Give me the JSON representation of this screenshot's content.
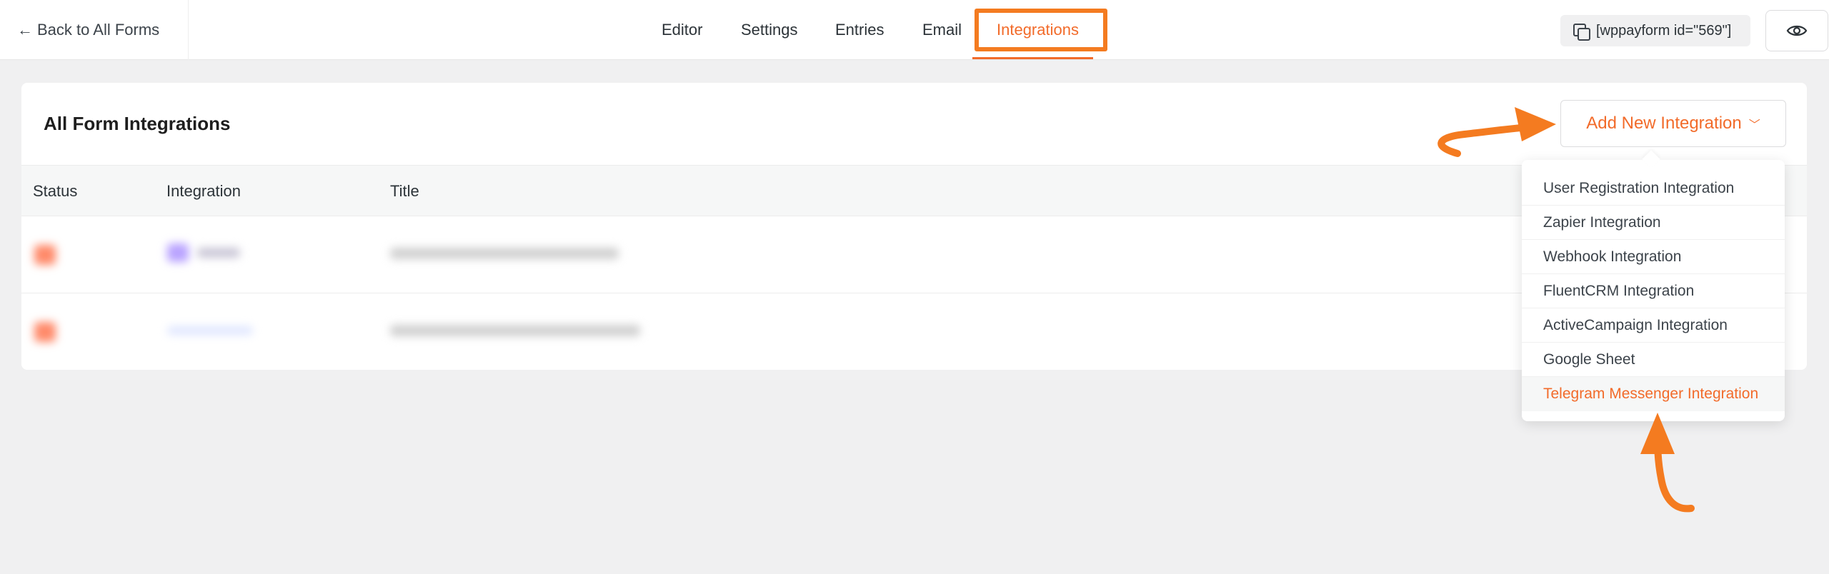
{
  "topbar": {
    "back_label": "Back to All Forms",
    "tabs": [
      {
        "label": "Editor"
      },
      {
        "label": "Settings"
      },
      {
        "label": "Entries"
      },
      {
        "label": "Email"
      },
      {
        "label": "Integrations"
      }
    ],
    "shortcode": "[wppayform id=\"569\"]"
  },
  "card": {
    "title": "All Form Integrations",
    "add_button_label": "Add New Integration"
  },
  "table": {
    "columns": [
      "Status",
      "Integration",
      "Title"
    ]
  },
  "dropdown": {
    "items": [
      "User Registration Integration",
      "Zapier Integration",
      "Webhook Integration",
      "FluentCRM Integration",
      "ActiveCampaign Integration",
      "Google Sheet",
      "Telegram Messenger Integration"
    ],
    "active_index": 6
  },
  "colors": {
    "accent": "#f26b2a",
    "annotation": "#f47b20"
  }
}
